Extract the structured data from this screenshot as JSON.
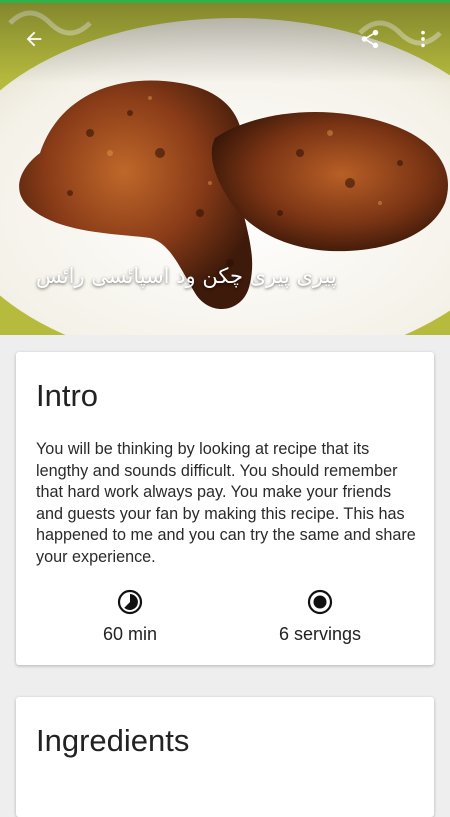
{
  "toolbar": {
    "back_icon": "arrow-back-icon",
    "share_icon": "share-icon",
    "overflow_icon": "more-vertical-icon"
  },
  "hero": {
    "title": "پیری پیری چکن ود اسپائسی رائس"
  },
  "intro": {
    "heading": "Intro",
    "text": "You will be thinking by looking at recipe that its lengthy and sounds difficult. You should remember that hard work always pay. You make your friends and guests your fan by making this recipe. This has happened to me and you can try the same and share your experience.",
    "time": {
      "icon": "timer-icon",
      "label": "60 min"
    },
    "servings": {
      "icon": "servings-icon",
      "label": "6 servings"
    }
  },
  "ingredients": {
    "heading": "Ingredients"
  },
  "colors": {
    "accent": "#2db34a",
    "background": "#eeeeee",
    "card": "#ffffff"
  }
}
